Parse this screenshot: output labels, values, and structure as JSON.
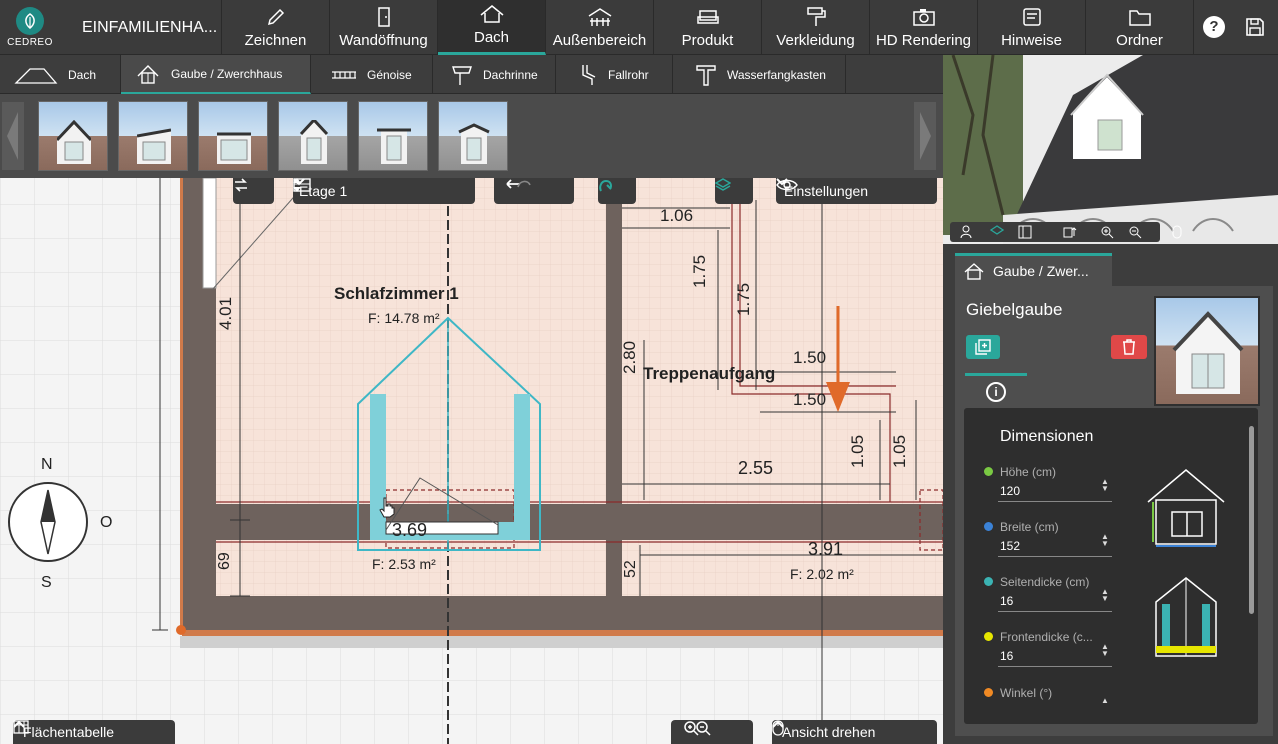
{
  "app": {
    "logo_text": "CEDREO",
    "project_name": "EINFAMILIENHA..."
  },
  "nav": {
    "items": [
      {
        "label": "Zeichnen",
        "icon": "pencil-icon"
      },
      {
        "label": "Wandöffnung",
        "icon": "door-icon"
      },
      {
        "label": "Dach",
        "icon": "roof-icon",
        "active": true
      },
      {
        "label": "Außenbereich",
        "icon": "fence-icon"
      },
      {
        "label": "Produkt",
        "icon": "sofa-icon"
      },
      {
        "label": "Verkleidung",
        "icon": "paint-roller-icon"
      },
      {
        "label": "HD Rendering",
        "icon": "camera-icon"
      },
      {
        "label": "Hinweise",
        "icon": "notes-icon"
      },
      {
        "label": "Ordner",
        "icon": "folder-icon"
      }
    ],
    "help": "?"
  },
  "subtabs": [
    {
      "label": "Dach",
      "icon": "roof-outline-icon"
    },
    {
      "label": "Gaube / Zwerchhaus",
      "icon": "dormer-icon",
      "active": true
    },
    {
      "label": "Génoise",
      "icon": "genoise-icon"
    },
    {
      "label": "Dachrinne",
      "icon": "gutter-icon"
    },
    {
      "label": "Fallrohr",
      "icon": "downpipe-icon"
    },
    {
      "label": "Wasserfangkasten",
      "icon": "rainhead-icon"
    }
  ],
  "toolbar": {
    "floor_label": "Etage 1",
    "settings_label": "Einstellungen"
  },
  "plan": {
    "rooms": [
      {
        "name": "Schlafzimmer 1",
        "area": "F: 14.78 m²"
      },
      {
        "name": "Treppenaufgang",
        "area": ""
      }
    ],
    "areas": [
      "F: 2.53 m²",
      "F: 2.02 m²"
    ],
    "dimensions": [
      "1.06",
      "1.06",
      "1.75",
      "1.75",
      "2.80",
      "1.50",
      "1.50",
      "1.05",
      "1.05",
      "2.55",
      "3.69",
      "3.91",
      "4.01",
      "69",
      "52"
    ]
  },
  "compass": {
    "n": "N",
    "s": "S",
    "o": "O"
  },
  "bottom": {
    "area_table": "Flächentabelle",
    "rotate_view": "Ansicht drehen"
  },
  "panel": {
    "tab_label": "Gaube / Zwer...",
    "title": "Giebelgaube",
    "section": "Dimensionen",
    "fields": [
      {
        "label": "Höhe (cm)",
        "value": "120",
        "color": "#7ac943"
      },
      {
        "label": "Breite (cm)",
        "value": "152",
        "color": "#3b82d6"
      },
      {
        "label": "Seitendicke (cm)",
        "value": "16",
        "color": "#3bb3b3"
      },
      {
        "label": "Frontendicke (c...",
        "value": "16",
        "color": "#e6e600"
      },
      {
        "label": "Winkel (°)",
        "value": "",
        "color": "#f08a24"
      }
    ]
  },
  "colors": {
    "accent": "#2aa79b",
    "delete": "#e04848",
    "wall": "#6e625d",
    "dormer": "#3fb7c6"
  }
}
